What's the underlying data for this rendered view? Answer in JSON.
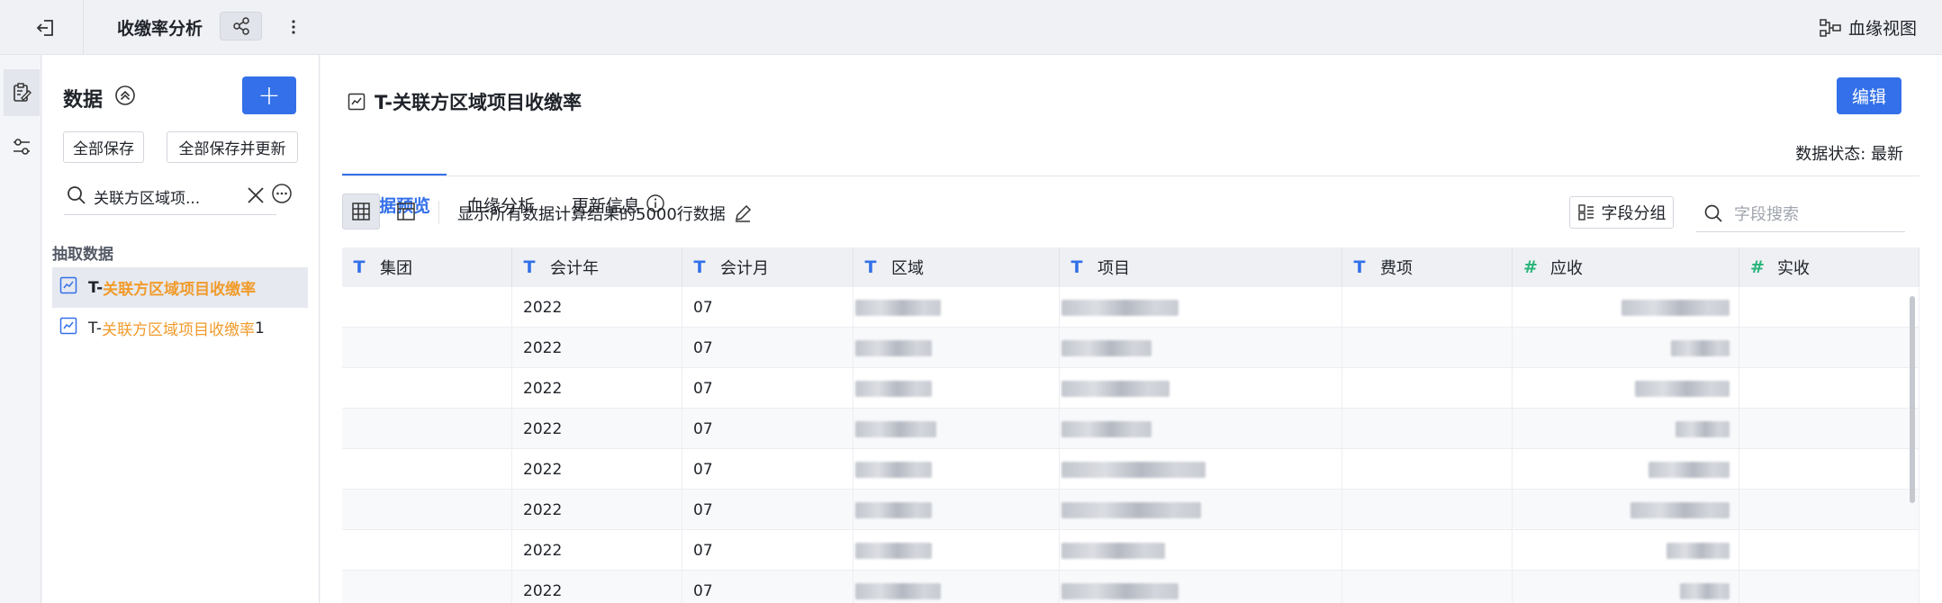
{
  "topbar": {
    "title": "收缴率分析",
    "lineage_view_label": "血缘视图"
  },
  "panel": {
    "title": "数据",
    "add_label": "+",
    "save_all_label": "全部保存",
    "save_all_update_label": "全部保存并更新",
    "search_value": "关联方区域项...",
    "section_label": "抽取数据",
    "tables": [
      {
        "prefix": "T-",
        "highlight": "关联方区域项目收缴率",
        "suffix": ""
      },
      {
        "prefix": "T-",
        "highlight": "关联方区域项目收缴率",
        "suffix": "1"
      }
    ]
  },
  "main": {
    "doc_title": "T-关联方区域项目收缴率",
    "edit_label": "编辑",
    "tabs": [
      "数据预览",
      "血缘分析",
      "更新信息"
    ],
    "data_status": "数据状态: 最新",
    "toolbar_text": "显示所有数据计算结果的5000行数据",
    "group_label": "字段分组",
    "field_search_placeholder": "字段搜索"
  },
  "grid": {
    "columns": [
      {
        "name": "集团",
        "type": "T"
      },
      {
        "name": "会计年",
        "type": "T"
      },
      {
        "name": "会计月",
        "type": "T"
      },
      {
        "name": "区域",
        "type": "T"
      },
      {
        "name": "项目",
        "type": "T"
      },
      {
        "name": "费项",
        "type": "T"
      },
      {
        "name": "应收",
        "type": "#"
      },
      {
        "name": "实收",
        "type": "#"
      }
    ],
    "rows": [
      {
        "year": "2022",
        "month": "07"
      },
      {
        "year": "2022",
        "month": "07"
      },
      {
        "year": "2022",
        "month": "07"
      },
      {
        "year": "2022",
        "month": "07"
      },
      {
        "year": "2022",
        "month": "07"
      },
      {
        "year": "2022",
        "month": "07"
      },
      {
        "year": "2022",
        "month": "07"
      },
      {
        "year": "2022",
        "month": "07"
      }
    ]
  },
  "colors": {
    "accent": "#3370e9",
    "highlight": "#f19b2b",
    "number_type": "#2bb47a"
  }
}
